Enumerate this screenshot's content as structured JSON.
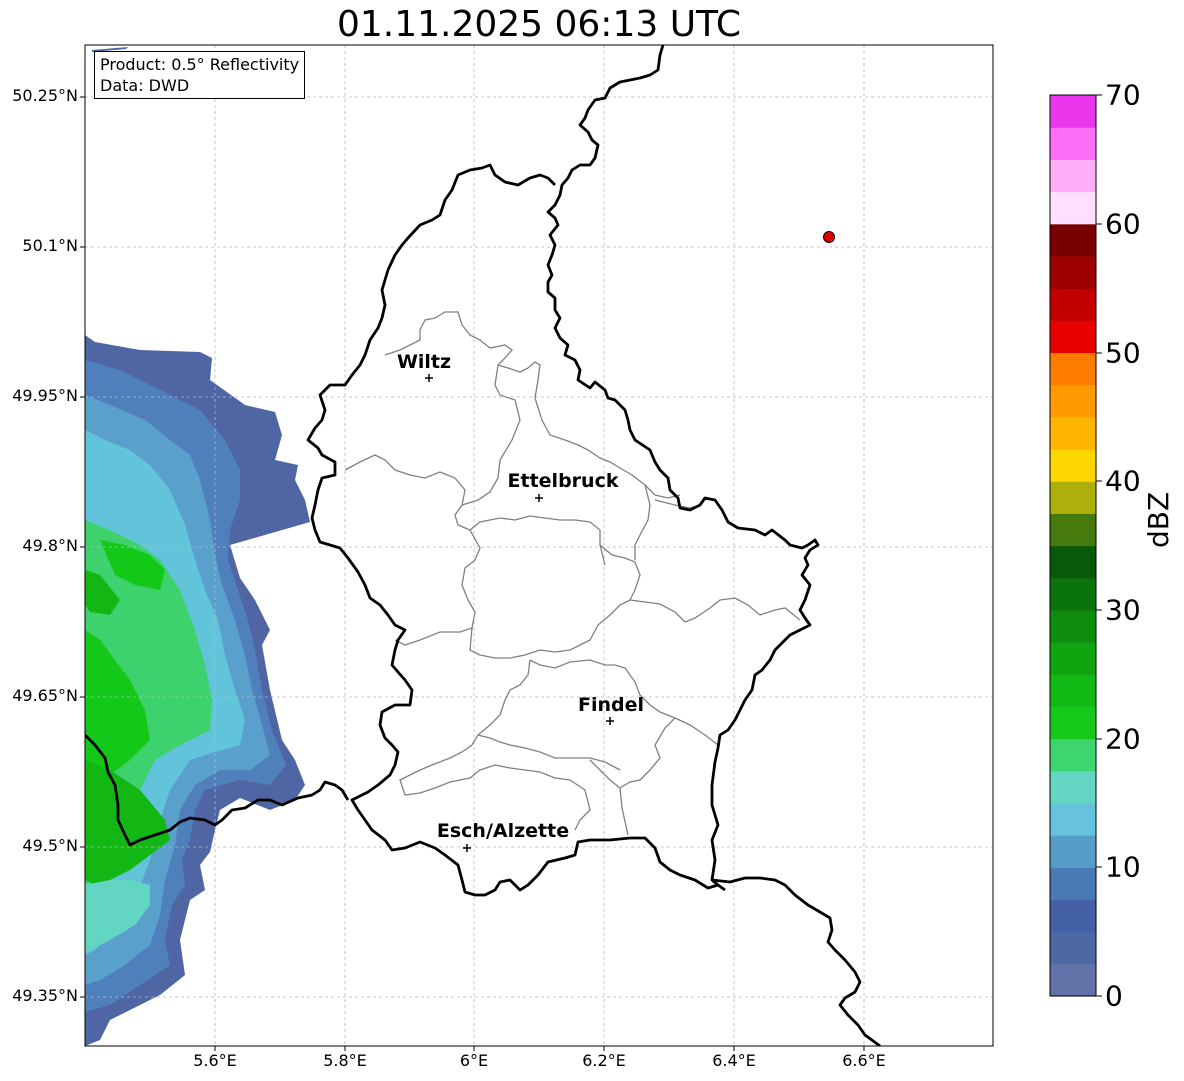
{
  "title": "01.11.2025 06:13 UTC",
  "info": {
    "product": "Product: 0.5° Reflectivity",
    "data": "Data: DWD"
  },
  "map": {
    "lat_labels": [
      "50.25°N",
      "50.1°N",
      "49.95°N",
      "49.8°N",
      "49.65°N",
      "49.5°N",
      "49.35°N"
    ],
    "lon_labels": [
      "5.6°E",
      "5.8°E",
      "6°E",
      "6.2°E",
      "6.4°E",
      "6.6°E"
    ],
    "cities": [
      {
        "name": "Wiltz"
      },
      {
        "name": "Ettelbruck"
      },
      {
        "name": "Findel"
      },
      {
        "name": "Esch/Alzette"
      }
    ],
    "radar_marker_color": "#e00000"
  },
  "colorbar": {
    "label": "dBZ",
    "ticks": [
      "0",
      "10",
      "20",
      "30",
      "40",
      "50",
      "60",
      "70"
    ],
    "colors": [
      "#6272a8",
      "#4e68a3",
      "#4460a6",
      "#4a7ab4",
      "#569ec8",
      "#66c2dd",
      "#62d6c2",
      "#3ed46e",
      "#14c91a",
      "#12b814",
      "#10a410",
      "#0e8c0e",
      "#0b730b",
      "#085a08",
      "#467a0c",
      "#adb00a",
      "#ffd700",
      "#ffb400",
      "#ff9a00",
      "#ff7c00",
      "#e80000",
      "#c20000",
      "#9c0000",
      "#780000",
      "#ffdfff",
      "#ffaff8",
      "#ff6ef8",
      "#ea36ec"
    ]
  }
}
